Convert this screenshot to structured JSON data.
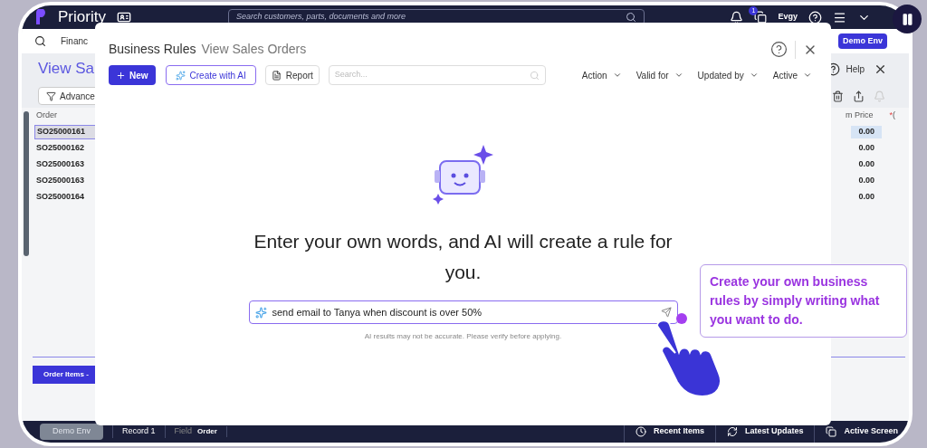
{
  "app": {
    "logo": "Priority",
    "search_placeholder": "Search customers, parts, documents and more",
    "notification_count": "1",
    "user": "Evgy"
  },
  "nav": {
    "menu_item": "Financ",
    "env_badge": "Demo Env"
  },
  "page": {
    "title": "View Sa",
    "filter_button": "Advance",
    "help": "Help",
    "order_column": "Order",
    "price_column": "m Price",
    "column_3": {
      "marker": "*",
      "label": "("
    },
    "rows": [
      {
        "order": "SO25000161",
        "price": "0.00",
        "selected": true
      },
      {
        "order": "SO25000162",
        "price": "0.00",
        "selected": false
      },
      {
        "order": "SO25000163",
        "price": "0.00",
        "selected": false
      },
      {
        "order": "SO25000163",
        "price": "0.00",
        "selected": false
      },
      {
        "order": "SO25000164",
        "price": "0.00",
        "selected": false
      }
    ],
    "tab": "Order Items -"
  },
  "modal": {
    "title": "Business Rules",
    "subtitle": "View Sales Orders",
    "new_button": "New",
    "ai_button": "Create with AI",
    "report_button": "Report",
    "search_placeholder": "Search...",
    "filters": [
      "Action",
      "Valid for",
      "Updated by",
      "Active"
    ],
    "heading": "Enter your own words, and AI will create a rule for you.",
    "prompt": "send email to Tanya when discount is over 50%",
    "disclaimer": "AI results may not be accurate. Please verify before applying."
  },
  "callout": "Create your own business rules by simply writing what you want to do.",
  "status_bar": {
    "env": "Demo Env",
    "record": "Record 1",
    "field_label": "Field",
    "field_value": "Order",
    "items": [
      "Recent Items",
      "Latest Updates",
      "Active Screen"
    ]
  }
}
